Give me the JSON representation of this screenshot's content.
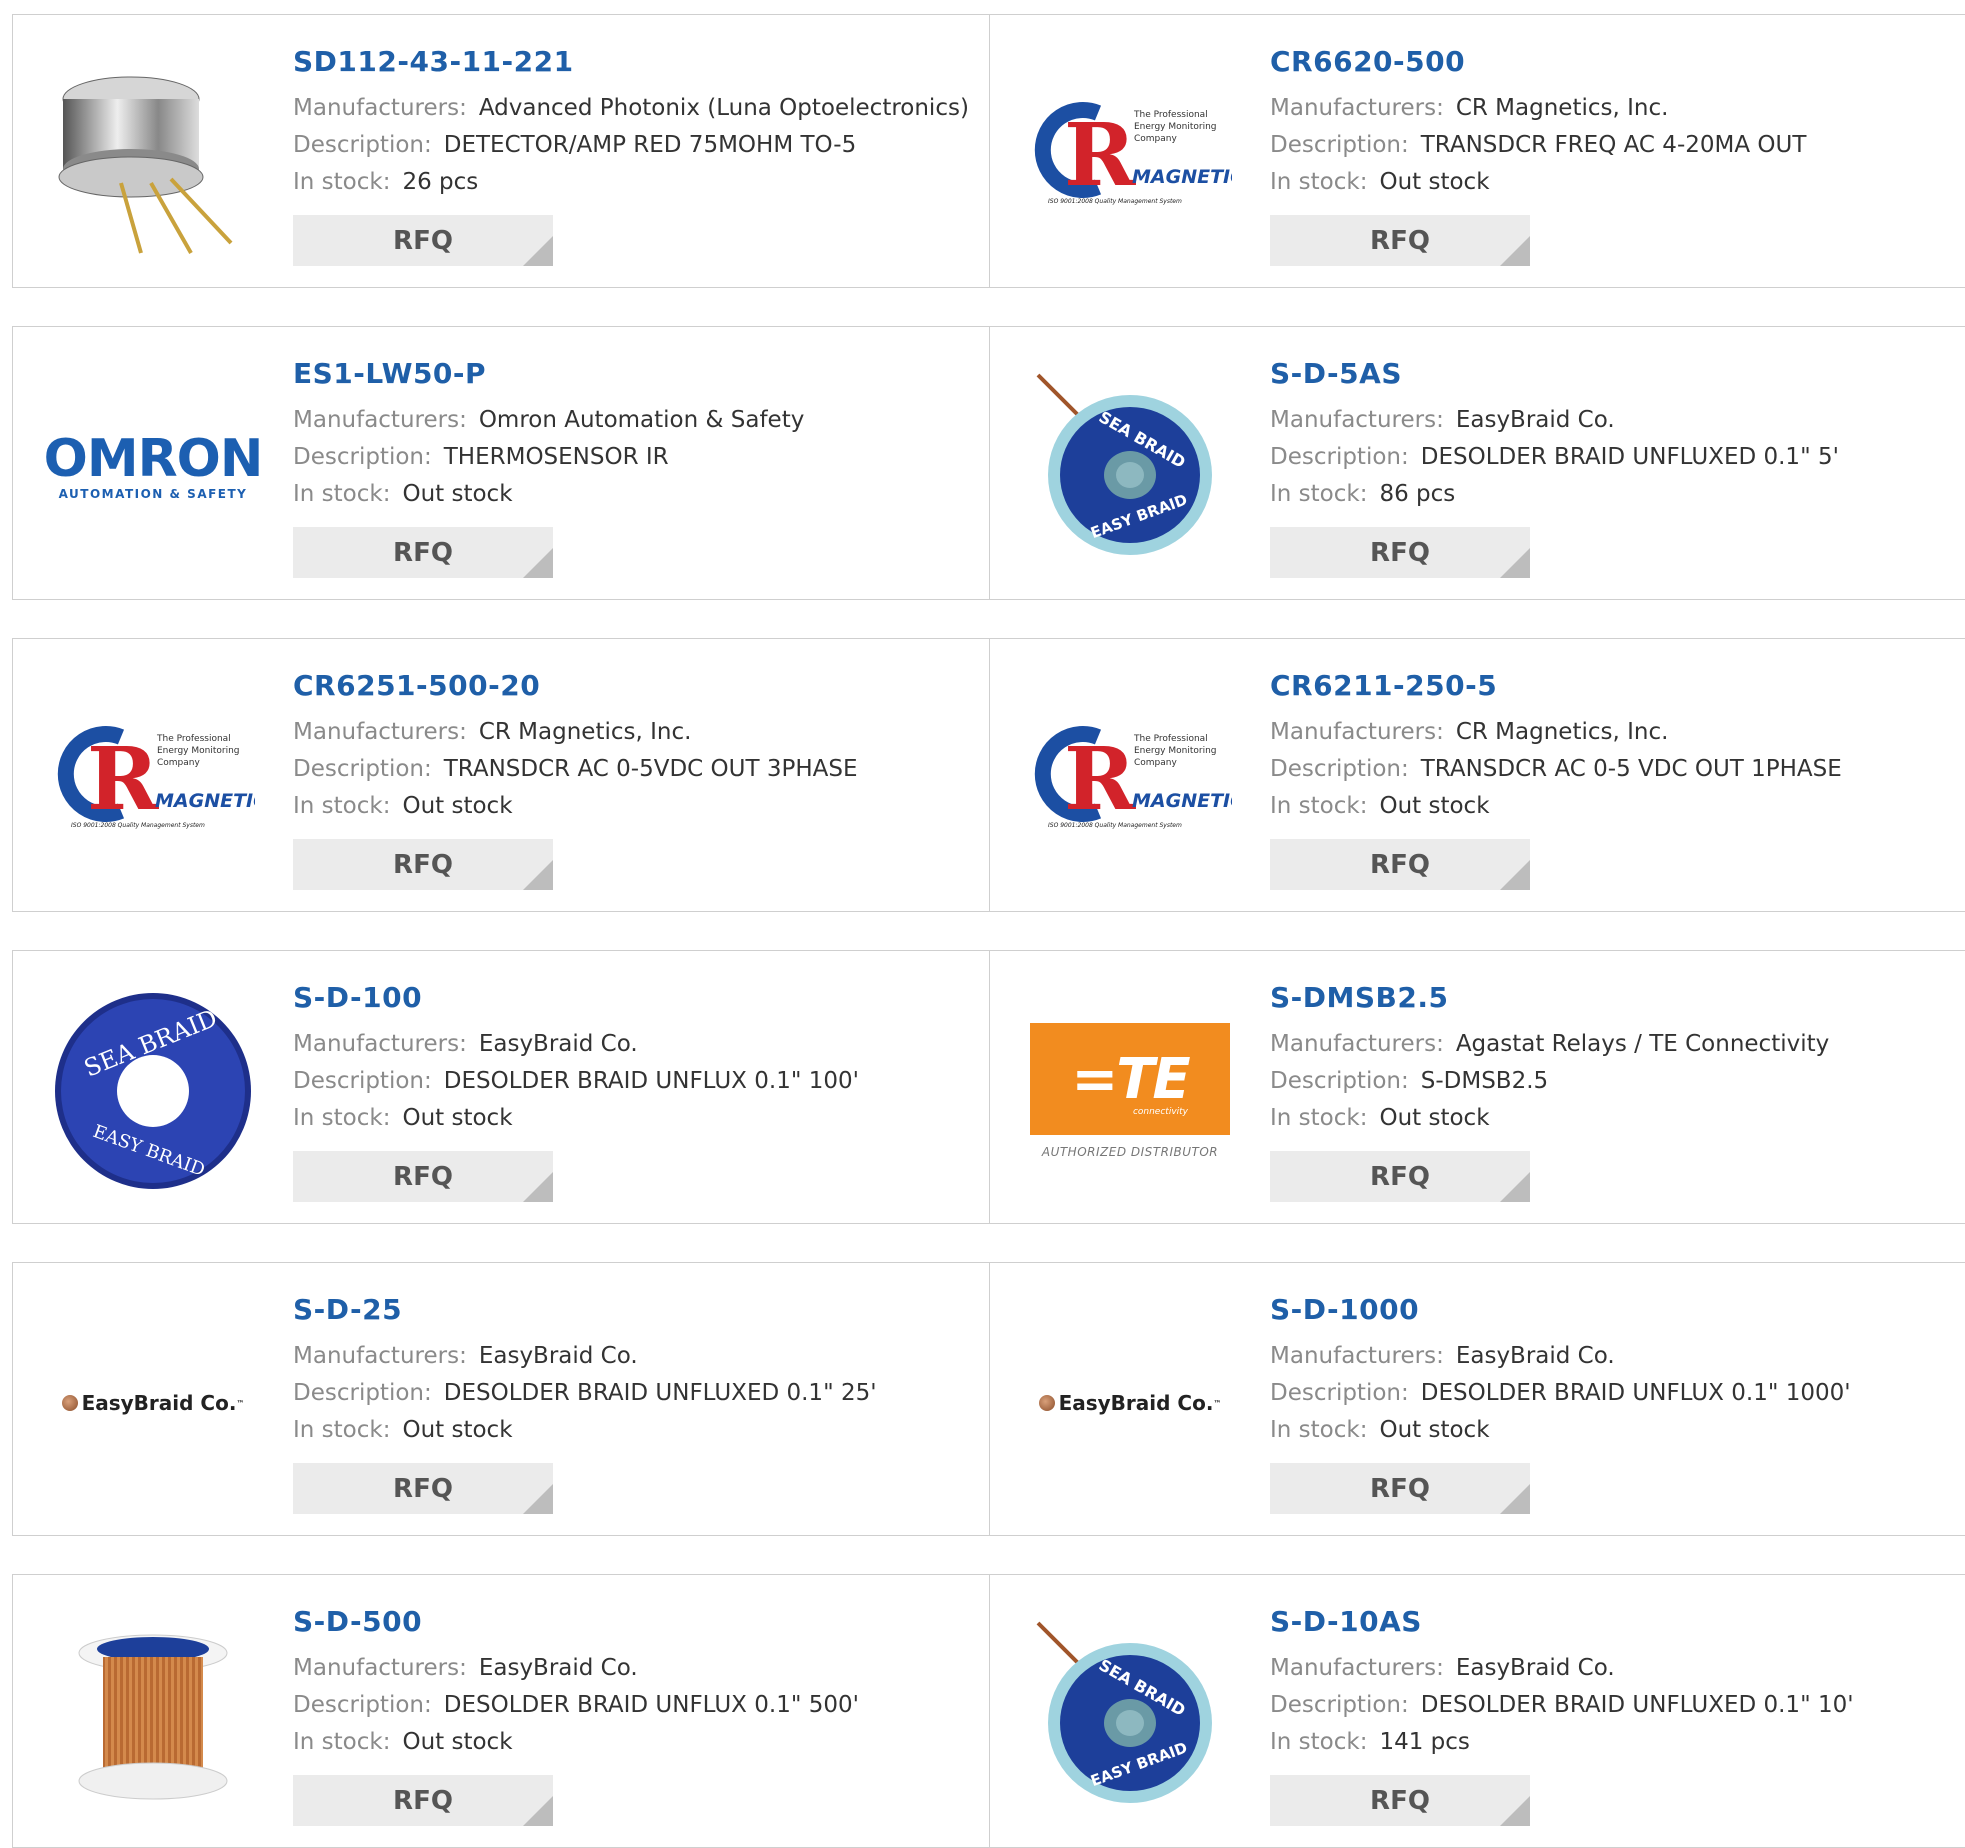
{
  "labels": {
    "manufacturers": "Manufacturers:",
    "description": "Description:",
    "in_stock": "In stock:",
    "rfq": "RFQ"
  },
  "products": [
    {
      "part": "SD112-43-11-221",
      "manufacturer": "Advanced Photonix (Luna Optoelectronics)",
      "description": "DETECTOR/AMP RED 75MOHM TO-5",
      "stock": "26 pcs",
      "image": "to5-detector-photo"
    },
    {
      "part": "CR6620-500",
      "manufacturer": "CR Magnetics, Inc.",
      "description": "TRANSDCR FREQ AC 4-20MA OUT",
      "stock": "Out stock",
      "image": "cr-magnetics-logo"
    },
    {
      "part": "ES1-LW50-P",
      "manufacturer": "Omron Automation & Safety",
      "description": "THERMOSENSOR IR",
      "stock": "Out stock",
      "image": "omron-logo"
    },
    {
      "part": "S-D-5AS",
      "manufacturer": "EasyBraid Co.",
      "description": "DESOLDER BRAID UNFLUXED 0.1\" 5'",
      "stock": "86 pcs",
      "image": "sea-braid-spool-photo"
    },
    {
      "part": "CR6251-500-20",
      "manufacturer": "CR Magnetics, Inc.",
      "description": "TRANSDCR AC 0-5VDC OUT 3PHASE",
      "stock": "Out stock",
      "image": "cr-magnetics-logo"
    },
    {
      "part": "CR6211-250-5",
      "manufacturer": "CR Magnetics, Inc.",
      "description": "TRANSDCR AC 0-5 VDC OUT 1PHASE",
      "stock": "Out stock",
      "image": "cr-magnetics-logo"
    },
    {
      "part": "S-D-100",
      "manufacturer": "EasyBraid Co.",
      "description": "DESOLDER BRAID UNFLUX 0.1\" 100'",
      "stock": "Out stock",
      "image": "sea-braid-dark-spool-photo"
    },
    {
      "part": "S-DMSB2.5",
      "manufacturer": "Agastat Relays / TE Connectivity",
      "description": "S-DMSB2.5",
      "stock": "Out stock",
      "image": "te-connectivity-logo"
    },
    {
      "part": "S-D-25",
      "manufacturer": "EasyBraid Co.",
      "description": "DESOLDER BRAID UNFLUXED 0.1\" 25'",
      "stock": "Out stock",
      "image": "easybraid-logo"
    },
    {
      "part": "S-D-1000",
      "manufacturer": "EasyBraid Co.",
      "description": "DESOLDER BRAID UNFLUX 0.1\" 1000'",
      "stock": "Out stock",
      "image": "easybraid-logo"
    },
    {
      "part": "S-D-500",
      "manufacturer": "EasyBraid Co.",
      "description": "DESOLDER BRAID UNFLUX 0.1\" 500'",
      "stock": "Out stock",
      "image": "copper-wire-spool-photo"
    },
    {
      "part": "S-D-10AS",
      "manufacturer": "EasyBraid Co.",
      "description": "DESOLDER BRAID UNFLUXED 0.1\" 10'",
      "stock": "141 pcs",
      "image": "sea-braid-spool-photo"
    }
  ],
  "logos": {
    "omron_big": "OMRON",
    "omron_small": "AUTOMATION & SAFETY",
    "easybraid": "EasyBraid Co.",
    "te_mark": "TE",
    "te_sub": "connectivity",
    "te_auth": "AUTHORIZED DISTRIBUTOR",
    "cr_tagline": "The Professional Energy Monitoring Company",
    "cr_magnetics": "MAGNETICS",
    "cr_iso": "ISO 9001:2008 Quality Management System",
    "seabraid": "SEA BRAID",
    "easy_braid_ring": "EASY BRAID"
  },
  "colors": {
    "title_blue": "#1f5fa8",
    "label_gray": "#8a8a8a",
    "button_bg": "#ebebeb",
    "border": "#cfcfcf"
  }
}
